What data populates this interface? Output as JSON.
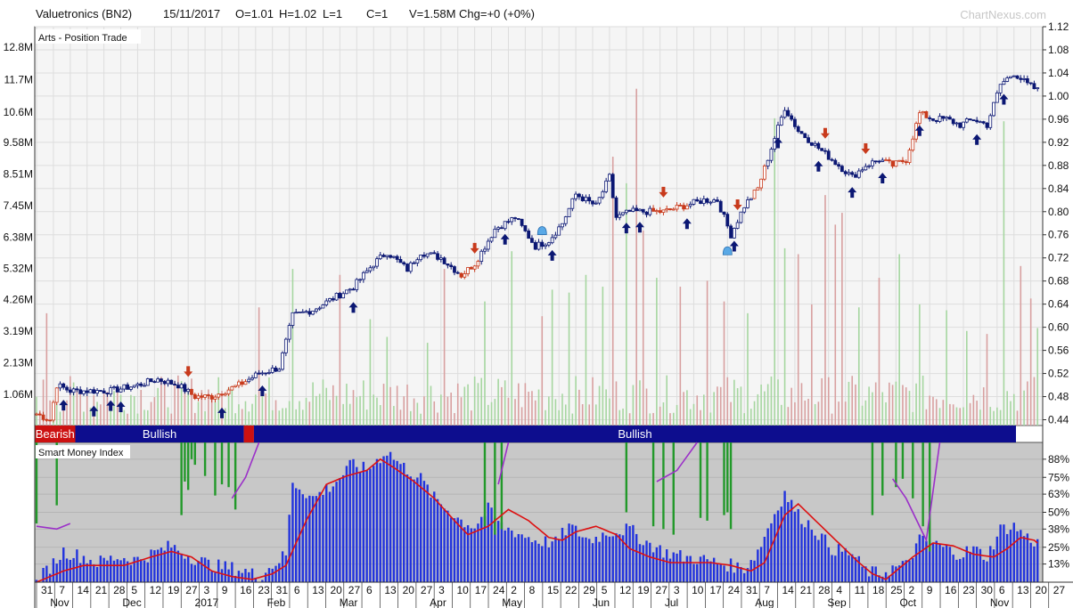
{
  "header": {
    "title": "Valuetronics (BN2)",
    "date": "15/11/2017",
    "open": "O=1.01",
    "high": "H=1.02",
    "low": "L=1",
    "close": "C=1",
    "volume": "V=1.58M Chg=+0 (+0%)",
    "brand": "ChartNexus.com"
  },
  "colors": {
    "bull_candle": "#0b1773",
    "bear_candle": "#c83a1c",
    "volume_up": "#a6d6a0",
    "volume_down": "#d8a0a0",
    "arrow_up": "#0b1773",
    "arrow_down": "#c83a1c",
    "trend_bullish": "#0d0d8e",
    "trend_bearish": "#cc1111",
    "smi_bar": "#2233dd",
    "smi_bar_green": "#22992a",
    "smi_line": "#dd1111",
    "smi_purple": "#9b30c8",
    "panel_bg": "#f5f5f5",
    "smi_bg": "#c8c8c8"
  },
  "chart_data": [
    {
      "type": "candlestick",
      "panel": "price",
      "label": "Arts - Position Trade",
      "y_ticks": [
        "1.12",
        "1.08",
        "1.04",
        "1.00",
        "0.96",
        "0.92",
        "0.88",
        "0.84",
        "0.80",
        "0.76",
        "0.72",
        "0.68",
        "0.64",
        "0.60",
        "0.56",
        "0.52",
        "0.48",
        "0.44"
      ],
      "ylim": [
        0.43,
        1.12
      ],
      "volume_ticks": [
        "12.8M",
        "11.7M",
        "10.6M",
        "9.58M",
        "8.51M",
        "7.45M",
        "6.38M",
        "5.32M",
        "4.26M",
        "3.19M",
        "2.13M",
        "1.06M"
      ],
      "volume_lim": [
        0,
        13.5
      ],
      "price_anchors": [
        [
          0,
          0.45
        ],
        [
          4,
          0.44
        ],
        [
          6,
          0.5
        ],
        [
          10,
          0.49
        ],
        [
          16,
          0.49
        ],
        [
          22,
          0.49
        ],
        [
          30,
          0.5
        ],
        [
          36,
          0.51
        ],
        [
          42,
          0.5
        ],
        [
          47,
          0.48
        ],
        [
          52,
          0.48
        ],
        [
          56,
          0.49
        ],
        [
          60,
          0.5
        ],
        [
          66,
          0.52
        ],
        [
          72,
          0.53
        ],
        [
          76,
          0.62
        ],
        [
          82,
          0.63
        ],
        [
          88,
          0.65
        ],
        [
          94,
          0.67
        ],
        [
          100,
          0.71
        ],
        [
          104,
          0.73
        ],
        [
          110,
          0.7
        ],
        [
          114,
          0.73
        ],
        [
          120,
          0.72
        ],
        [
          126,
          0.69
        ],
        [
          130,
          0.71
        ],
        [
          136,
          0.77
        ],
        [
          142,
          0.79
        ],
        [
          148,
          0.74
        ],
        [
          152,
          0.75
        ],
        [
          156,
          0.78
        ],
        [
          160,
          0.83
        ],
        [
          166,
          0.81
        ],
        [
          170,
          0.86
        ],
        [
          172,
          0.79
        ],
        [
          176,
          0.8
        ],
        [
          180,
          0.8
        ],
        [
          186,
          0.8
        ],
        [
          192,
          0.81
        ],
        [
          198,
          0.82
        ],
        [
          202,
          0.82
        ],
        [
          206,
          0.76
        ],
        [
          210,
          0.81
        ],
        [
          214,
          0.84
        ],
        [
          218,
          0.91
        ],
        [
          222,
          0.98
        ],
        [
          226,
          0.94
        ],
        [
          230,
          0.92
        ],
        [
          234,
          0.9
        ],
        [
          238,
          0.88
        ],
        [
          242,
          0.86
        ],
        [
          246,
          0.88
        ],
        [
          250,
          0.89
        ],
        [
          254,
          0.88
        ],
        [
          258,
          0.89
        ],
        [
          262,
          0.97
        ],
        [
          266,
          0.96
        ],
        [
          270,
          0.96
        ],
        [
          274,
          0.95
        ],
        [
          278,
          0.96
        ],
        [
          282,
          0.95
        ],
        [
          286,
          1.02
        ],
        [
          290,
          1.04
        ],
        [
          294,
          1.02
        ],
        [
          297,
          1.01
        ]
      ],
      "bearish_runs": [
        [
          0,
          6
        ],
        [
          46,
          62
        ],
        [
          126,
          131
        ],
        [
          183,
          193
        ],
        [
          213,
          216
        ],
        [
          252,
          264
        ]
      ],
      "volume_spikes": [
        [
          3,
          3.8
        ],
        [
          66,
          4.0
        ],
        [
          76,
          5.3
        ],
        [
          90,
          5.1
        ],
        [
          99,
          3.6
        ],
        [
          104,
          3.0
        ],
        [
          116,
          2.8
        ],
        [
          121,
          5.3
        ],
        [
          133,
          4.2
        ],
        [
          141,
          5.9
        ],
        [
          150,
          3.7
        ],
        [
          153,
          4.6
        ],
        [
          158,
          4.5
        ],
        [
          163,
          5.1
        ],
        [
          168,
          4.7
        ],
        [
          171,
          9.1
        ],
        [
          175,
          8.2
        ],
        [
          178,
          11.4
        ],
        [
          180,
          6.6
        ],
        [
          184,
          5.0
        ],
        [
          191,
          4.7
        ],
        [
          199,
          4.9
        ],
        [
          204,
          4.2
        ],
        [
          211,
          3.8
        ],
        [
          219,
          10.4
        ],
        [
          222,
          6.0
        ],
        [
          226,
          5.8
        ],
        [
          230,
          4.1
        ],
        [
          234,
          7.8
        ],
        [
          237,
          6.8
        ],
        [
          239,
          7.2
        ],
        [
          244,
          4.0
        ],
        [
          250,
          5.0
        ],
        [
          256,
          5.8
        ],
        [
          262,
          4.1
        ],
        [
          270,
          3.9
        ],
        [
          276,
          3.2
        ],
        [
          282,
          3.1
        ],
        [
          287,
          10.3
        ],
        [
          292,
          5.4
        ],
        [
          295,
          4.3
        ],
        [
          297,
          3.3
        ]
      ]
    },
    {
      "type": "band",
      "panel": "trend",
      "segments": [
        {
          "label": "Bearish",
          "state": "bearish",
          "from": 0,
          "to": 12
        },
        {
          "label": "Bullish",
          "state": "bullish",
          "from": 12,
          "to": 62
        },
        {
          "label": "",
          "state": "bearish",
          "from": 62,
          "to": 65
        },
        {
          "label": "Bullish",
          "state": "bullish",
          "from": 65,
          "to": 298
        }
      ]
    },
    {
      "type": "bar",
      "panel": "indicator",
      "title": "Smart Money Index",
      "y_ticks": [
        "88%",
        "75%",
        "63%",
        "50%",
        "38%",
        "25%",
        "13%"
      ],
      "ylim": [
        0,
        100
      ],
      "bar_anchors": [
        [
          0,
          0
        ],
        [
          8,
          22
        ],
        [
          14,
          18
        ],
        [
          18,
          14
        ],
        [
          24,
          18
        ],
        [
          30,
          16
        ],
        [
          36,
          22
        ],
        [
          40,
          26
        ],
        [
          46,
          18
        ],
        [
          52,
          12
        ],
        [
          58,
          10
        ],
        [
          62,
          8
        ],
        [
          66,
          4
        ],
        [
          70,
          12
        ],
        [
          74,
          20
        ],
        [
          76,
          72
        ],
        [
          82,
          60
        ],
        [
          88,
          70
        ],
        [
          94,
          85
        ],
        [
          98,
          80
        ],
        [
          104,
          94
        ],
        [
          108,
          84
        ],
        [
          114,
          74
        ],
        [
          118,
          60
        ],
        [
          122,
          52
        ],
        [
          126,
          44
        ],
        [
          130,
          40
        ],
        [
          134,
          52
        ],
        [
          138,
          40
        ],
        [
          144,
          34
        ],
        [
          148,
          30
        ],
        [
          154,
          28
        ],
        [
          158,
          40
        ],
        [
          164,
          30
        ],
        [
          170,
          36
        ],
        [
          176,
          38
        ],
        [
          180,
          30
        ],
        [
          186,
          22
        ],
        [
          192,
          18
        ],
        [
          198,
          16
        ],
        [
          202,
          14
        ],
        [
          206,
          12
        ],
        [
          210,
          10
        ],
        [
          214,
          22
        ],
        [
          218,
          44
        ],
        [
          222,
          64
        ],
        [
          226,
          48
        ],
        [
          230,
          40
        ],
        [
          236,
          24
        ],
        [
          242,
          20
        ],
        [
          246,
          8
        ],
        [
          250,
          6
        ],
        [
          254,
          10
        ],
        [
          258,
          12
        ],
        [
          262,
          30
        ],
        [
          266,
          28
        ],
        [
          270,
          24
        ],
        [
          274,
          20
        ],
        [
          278,
          24
        ],
        [
          282,
          18
        ],
        [
          286,
          38
        ],
        [
          290,
          40
        ],
        [
          294,
          32
        ],
        [
          297,
          28
        ]
      ],
      "line_anchors": [
        [
          0,
          0
        ],
        [
          8,
          8
        ],
        [
          14,
          12
        ],
        [
          20,
          12
        ],
        [
          26,
          12
        ],
        [
          34,
          18
        ],
        [
          40,
          22
        ],
        [
          46,
          18
        ],
        [
          52,
          8
        ],
        [
          58,
          4
        ],
        [
          64,
          2
        ],
        [
          70,
          6
        ],
        [
          74,
          12
        ],
        [
          80,
          44
        ],
        [
          86,
          70
        ],
        [
          92,
          76
        ],
        [
          98,
          80
        ],
        [
          102,
          88
        ],
        [
          106,
          82
        ],
        [
          112,
          72
        ],
        [
          118,
          60
        ],
        [
          124,
          44
        ],
        [
          128,
          34
        ],
        [
          134,
          40
        ],
        [
          140,
          52
        ],
        [
          146,
          44
        ],
        [
          152,
          32
        ],
        [
          156,
          30
        ],
        [
          160,
          36
        ],
        [
          166,
          40
        ],
        [
          172,
          34
        ],
        [
          176,
          24
        ],
        [
          182,
          18
        ],
        [
          188,
          14
        ],
        [
          194,
          14
        ],
        [
          200,
          14
        ],
        [
          206,
          12
        ],
        [
          212,
          8
        ],
        [
          216,
          14
        ],
        [
          222,
          48
        ],
        [
          226,
          56
        ],
        [
          232,
          42
        ],
        [
          238,
          28
        ],
        [
          244,
          14
        ],
        [
          248,
          6
        ],
        [
          252,
          2
        ],
        [
          256,
          10
        ],
        [
          260,
          18
        ],
        [
          266,
          28
        ],
        [
          272,
          26
        ],
        [
          278,
          20
        ],
        [
          284,
          18
        ],
        [
          288,
          24
        ],
        [
          292,
          32
        ],
        [
          296,
          30
        ],
        [
          297,
          28
        ]
      ],
      "green_bars": [
        [
          0,
          42
        ],
        [
          6,
          55
        ],
        [
          43,
          48
        ],
        [
          44,
          72
        ],
        [
          45,
          66
        ],
        [
          46,
          88
        ],
        [
          47,
          84
        ],
        [
          50,
          76
        ],
        [
          53,
          62
        ],
        [
          55,
          70
        ],
        [
          57,
          68
        ],
        [
          59,
          52
        ],
        [
          133,
          40
        ],
        [
          136,
          34
        ],
        [
          138,
          38
        ],
        [
          175,
          50
        ],
        [
          183,
          40
        ],
        [
          186,
          38
        ],
        [
          189,
          34
        ],
        [
          197,
          46
        ],
        [
          199,
          44
        ],
        [
          204,
          48
        ],
        [
          205,
          50
        ],
        [
          206,
          38
        ],
        [
          248,
          48
        ],
        [
          251,
          62
        ],
        [
          255,
          68
        ],
        [
          257,
          74
        ],
        [
          260,
          60
        ],
        [
          263,
          40
        ],
        [
          265,
          22
        ]
      ]
    }
  ],
  "x_axis": {
    "days": [
      "31",
      "7",
      "14",
      "21",
      "28",
      "5",
      "12",
      "19",
      "27",
      "3",
      "9",
      "16",
      "23",
      "31",
      "6",
      "13",
      "20",
      "27",
      "6",
      "13",
      "20",
      "27",
      "3",
      "10",
      "17",
      "24",
      "2",
      "8",
      "15",
      "22",
      "29",
      "5",
      "12",
      "19",
      "27",
      "3",
      "10",
      "17",
      "24",
      "31",
      "7",
      "14",
      "21",
      "28",
      "4",
      "11",
      "18",
      "25",
      "2",
      "9",
      "16",
      "23",
      "30",
      "6",
      "13",
      "20",
      "27"
    ],
    "months": [
      "Nov",
      "Dec",
      "2017",
      "Feb",
      "Mar",
      "Apr",
      "May",
      "Jun",
      "Jul",
      "Aug",
      "Sep",
      "Oct",
      "Nov"
    ]
  }
}
